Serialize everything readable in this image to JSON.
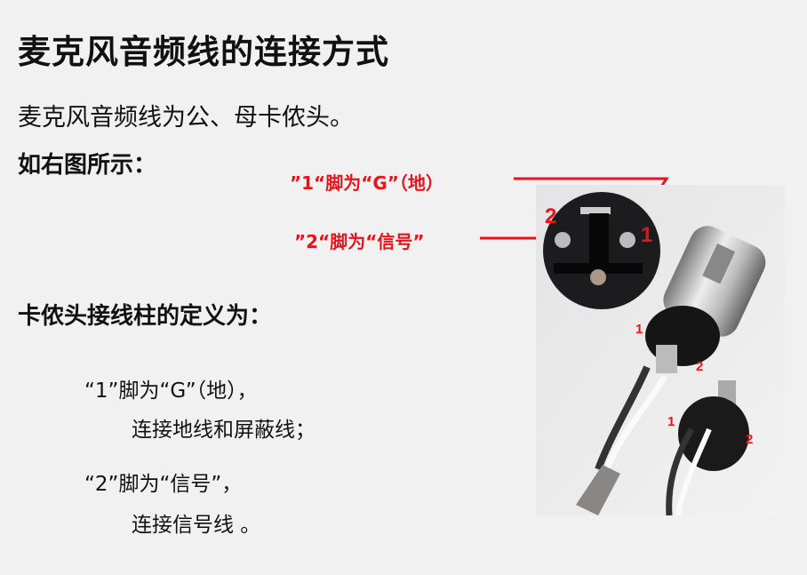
{
  "title": "麦克风音频线的连接方式",
  "subtitle": "麦克风音频线为公、母卡侬头。",
  "see_right": "如右图所示：",
  "callouts": {
    "pin1": "”1“脚为“G”（地）",
    "pin2": "”2“脚为“信号”",
    "color": "#e8141b"
  },
  "definitions_heading": "卡侬头接线柱的定义为：",
  "definitions": [
    {
      "line1": "“1”脚为“G”（地），",
      "line2": "连接地线和屏蔽线；"
    },
    {
      "line1": "“2”脚为“信号”，",
      "line2": "连接信号线 。"
    }
  ],
  "photo_labels": {
    "socket": [
      "2",
      "1"
    ],
    "plug_top": [
      "1",
      "2"
    ],
    "plug_bottom": [
      "1",
      "2"
    ]
  }
}
